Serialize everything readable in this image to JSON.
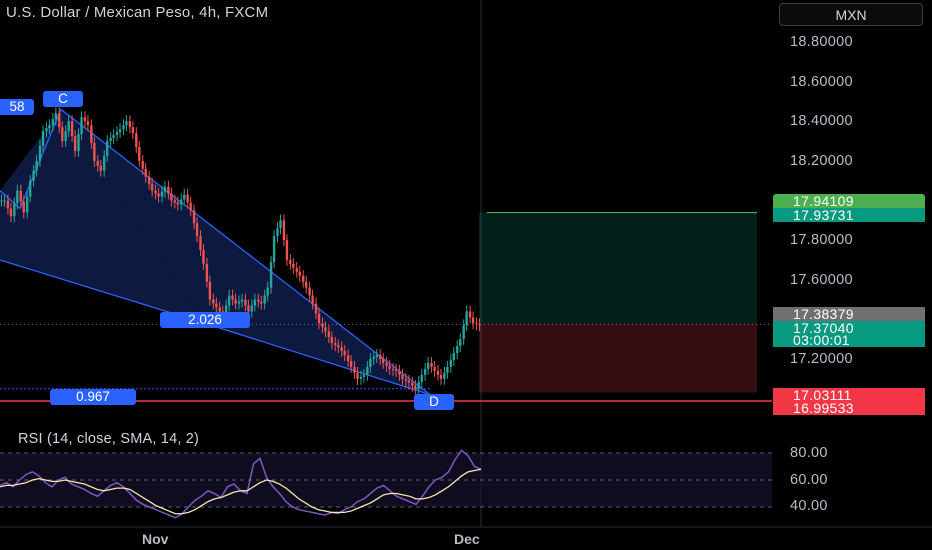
{
  "header": {
    "title": "U.S. Dollar / Mexican Peso, 4h, FXCM",
    "currency_button": "MXN"
  },
  "colors": {
    "up": "#26a69a",
    "down": "#ef5350",
    "pattern": "#2962ff",
    "pattern_fill": "#0e1c45",
    "rsi_line": "#7e57c2",
    "rsi_sma": "#f5e6b3",
    "target": "#089981",
    "stop": "#f23645"
  },
  "rsi_panel": {
    "label": "RSI (14, close, SMA, 14, 2)"
  },
  "price_tags": {
    "target_upper": "17.94109",
    "target_lower": "17.93731",
    "last_grey": "17.38379",
    "last_close": "17.37040",
    "countdown": "03:00:01",
    "stop_upper": "17.03111",
    "stop_lower": "16.99533"
  },
  "pattern_labels": {
    "c": "C",
    "d": "D",
    "ratio_left": "58",
    "ratio_mid": "2.026",
    "ratio_bottom": "0.967"
  },
  "chart_data": [
    {
      "type": "candlestick",
      "title": "U.S. Dollar / Mexican Peso, 4h, FXCM",
      "x_ticks": [
        "Nov",
        "Dec"
      ],
      "y_ticks": [
        "18.80000",
        "18.60000",
        "18.40000",
        "18.20000",
        "17.80000",
        "17.60000",
        "17.20000"
      ],
      "ylim": [
        16.93,
        19.0
      ],
      "pattern_points": {
        "X": 18.05,
        "C": 18.46,
        "mid_low": 17.38,
        "D": 17.02
      },
      "position": {
        "entry": 17.38,
        "target": 17.939,
        "stop": 17.031
      },
      "closes": [
        18.0,
        17.92,
        18.05,
        17.94,
        18.1,
        18.2,
        18.35,
        18.38,
        18.44,
        18.3,
        18.4,
        18.25,
        18.42,
        18.38,
        18.2,
        18.15,
        18.3,
        18.33,
        18.36,
        18.4,
        18.34,
        18.2,
        18.12,
        18.05,
        18.02,
        18.07,
        18.0,
        17.98,
        18.03,
        17.95,
        17.82,
        17.68,
        17.5,
        17.46,
        17.42,
        17.52,
        17.48,
        17.5,
        17.44,
        17.5,
        17.48,
        17.56,
        17.82,
        17.9,
        17.7,
        17.66,
        17.62,
        17.56,
        17.48,
        17.38,
        17.34,
        17.28,
        17.26,
        17.22,
        17.16,
        17.1,
        17.12,
        17.2,
        17.22,
        17.18,
        17.15,
        17.14,
        17.1,
        17.08,
        17.05,
        17.12,
        17.18,
        17.14,
        17.1,
        17.16,
        17.23,
        17.3,
        17.44,
        17.38,
        17.37
      ]
    },
    {
      "type": "line",
      "title": "RSI (14, close, SMA, 14, 2)",
      "y_ticks": [
        "80.00",
        "60.00",
        "40.00"
      ],
      "ylim": [
        30,
        90
      ],
      "series": [
        {
          "values": [
            56,
            58,
            55,
            60,
            64,
            66,
            63,
            58,
            55,
            60,
            62,
            57,
            55,
            53,
            50,
            48,
            52,
            56,
            58,
            55,
            50,
            45,
            42,
            40,
            38,
            36,
            34,
            32,
            35,
            40,
            45,
            48,
            52,
            50,
            47,
            55,
            57,
            52,
            50,
            72,
            76,
            62,
            55,
            50,
            44,
            40,
            38,
            37,
            36,
            35,
            34,
            36,
            35,
            38,
            40,
            44,
            46,
            50,
            54,
            56,
            52,
            48,
            46,
            44,
            42,
            48,
            55,
            60,
            62,
            66,
            75,
            82,
            78,
            70,
            68
          ]
        },
        {
          "values": [
            55,
            56,
            56,
            57,
            58,
            60,
            61,
            60,
            59,
            59,
            60,
            59,
            58,
            57,
            55,
            53,
            52,
            53,
            54,
            54,
            53,
            50,
            47,
            44,
            41,
            39,
            37,
            35,
            35,
            36,
            38,
            41,
            44,
            46,
            47,
            49,
            51,
            52,
            52,
            55,
            58,
            60,
            59,
            57,
            54,
            50,
            46,
            43,
            40,
            38,
            37,
            36,
            36,
            36,
            37,
            39,
            41,
            43,
            46,
            49,
            50,
            50,
            49,
            48,
            46,
            46,
            47,
            49,
            52,
            55,
            59,
            63,
            66,
            67,
            68
          ]
        }
      ],
      "bands": [
        80,
        60,
        40
      ]
    }
  ]
}
